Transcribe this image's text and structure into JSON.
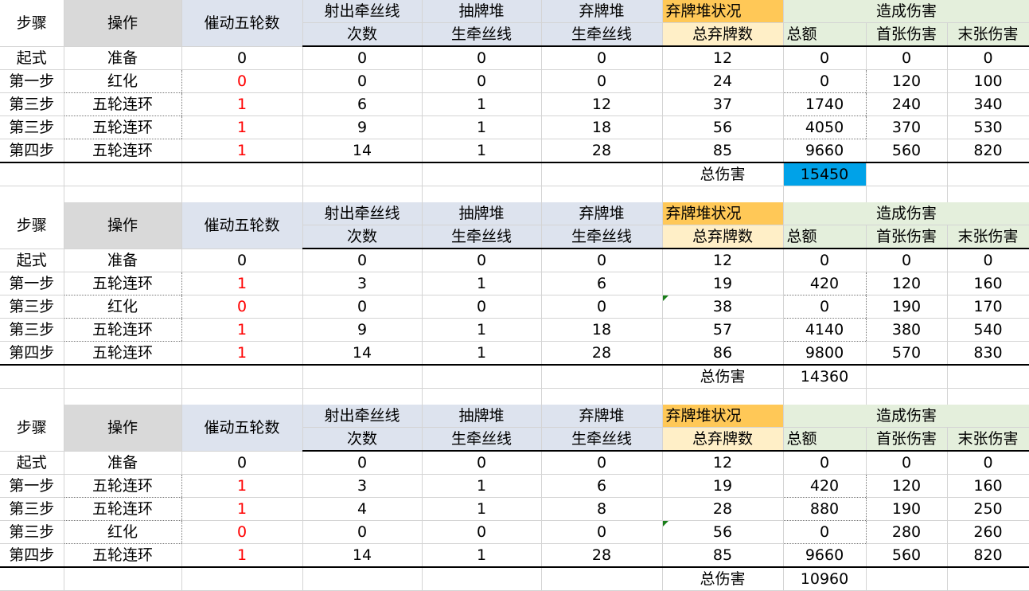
{
  "headers": {
    "step": "步骤",
    "op": "操作",
    "wheels": "催动五轮数",
    "shoot_1": "射出牵丝线",
    "shoot_2": "次数",
    "draw_1": "抽牌堆",
    "draw_2": "生牵丝线",
    "discard_1": "弃牌堆",
    "discard_2": "生牵丝线",
    "status_1": "弃牌堆状况",
    "status_2": "总弃牌数",
    "damage_1": "造成伤害",
    "total": "总额",
    "first": "首张伤害",
    "last": "末张伤害"
  },
  "total_label": "总伤害",
  "colors": {
    "gray_header": "#d9d9d9",
    "blue_header": "#dde3ee",
    "orange_header": "#ffc857",
    "cream_header": "#ffefc7",
    "green_header": "#e4efdc",
    "highlight": "#00a2e8",
    "zero_wheel_red": "#ff0000"
  },
  "tables": [
    {
      "rows": [
        {
          "step": "起式",
          "op": "准备",
          "wheels": "0",
          "shoot": "0",
          "draw": "0",
          "discard": "0",
          "total_discards": "12",
          "total": "0",
          "first": "0",
          "last": "0"
        },
        {
          "step": "第一步",
          "op": "红化",
          "wheels": "0",
          "shoot": "0",
          "draw": "0",
          "discard": "0",
          "total_discards": "24",
          "total": "0",
          "first": "120",
          "last": "100"
        },
        {
          "step": "第三步",
          "op": "五轮连环",
          "wheels": "1",
          "shoot": "6",
          "draw": "1",
          "discard": "12",
          "total_discards": "37",
          "total": "1740",
          "first": "240",
          "last": "340"
        },
        {
          "step": "第三步",
          "op": "五轮连环",
          "wheels": "1",
          "shoot": "9",
          "draw": "1",
          "discard": "18",
          "total_discards": "56",
          "total": "4050",
          "first": "370",
          "last": "530"
        },
        {
          "step": "第四步",
          "op": "五轮连环",
          "wheels": "1",
          "shoot": "14",
          "draw": "1",
          "discard": "28",
          "total_discards": "85",
          "total": "9660",
          "first": "560",
          "last": "820"
        }
      ],
      "total_damage": "15450"
    },
    {
      "rows": [
        {
          "step": "起式",
          "op": "准备",
          "wheels": "0",
          "shoot": "0",
          "draw": "0",
          "discard": "0",
          "total_discards": "12",
          "total": "0",
          "first": "0",
          "last": "0"
        },
        {
          "step": "第一步",
          "op": "五轮连环",
          "wheels": "1",
          "shoot": "3",
          "draw": "1",
          "discard": "6",
          "total_discards": "19",
          "total": "420",
          "first": "120",
          "last": "160"
        },
        {
          "step": "第三步",
          "op": "红化",
          "wheels": "0",
          "shoot": "0",
          "draw": "0",
          "discard": "0",
          "total_discards": "38",
          "total": "0",
          "first": "190",
          "last": "170"
        },
        {
          "step": "第三步",
          "op": "五轮连环",
          "wheels": "1",
          "shoot": "9",
          "draw": "1",
          "discard": "18",
          "total_discards": "57",
          "total": "4140",
          "first": "380",
          "last": "540"
        },
        {
          "step": "第四步",
          "op": "五轮连环",
          "wheels": "1",
          "shoot": "14",
          "draw": "1",
          "discard": "28",
          "total_discards": "86",
          "total": "9800",
          "first": "570",
          "last": "830"
        }
      ],
      "total_damage": "14360"
    },
    {
      "rows": [
        {
          "step": "起式",
          "op": "准备",
          "wheels": "0",
          "shoot": "0",
          "draw": "0",
          "discard": "0",
          "total_discards": "12",
          "total": "0",
          "first": "0",
          "last": "0"
        },
        {
          "step": "第一步",
          "op": "五轮连环",
          "wheels": "1",
          "shoot": "3",
          "draw": "1",
          "discard": "6",
          "total_discards": "19",
          "total": "420",
          "first": "120",
          "last": "160"
        },
        {
          "step": "第三步",
          "op": "五轮连环",
          "wheels": "1",
          "shoot": "4",
          "draw": "1",
          "discard": "8",
          "total_discards": "28",
          "total": "880",
          "first": "190",
          "last": "250"
        },
        {
          "step": "第三步",
          "op": "红化",
          "wheels": "0",
          "shoot": "0",
          "draw": "0",
          "discard": "0",
          "total_discards": "56",
          "total": "0",
          "first": "280",
          "last": "260"
        },
        {
          "step": "第四步",
          "op": "五轮连环",
          "wheels": "1",
          "shoot": "14",
          "draw": "1",
          "discard": "28",
          "total_discards": "85",
          "total": "9660",
          "first": "560",
          "last": "820"
        }
      ],
      "total_damage": "10960"
    }
  ]
}
